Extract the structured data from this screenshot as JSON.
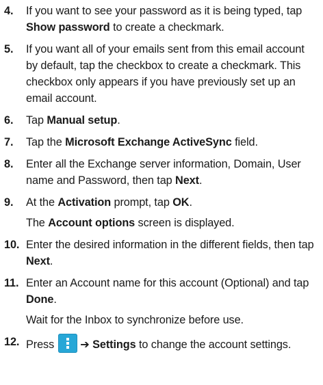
{
  "steps": [
    {
      "num": "4.",
      "pre": "If you want to see your password as it is being typed, tap ",
      "bold": "Show password",
      "post": " to create a checkmark."
    },
    {
      "num": "5.",
      "text": "If you want all of your emails sent from this email account by default, tap the checkbox to create a checkmark. This checkbox only appears if you have previously set up an email account."
    },
    {
      "num": "6.",
      "pre": "Tap ",
      "bold": "Manual setup",
      "post": "."
    },
    {
      "num": "7.",
      "pre": "Tap the ",
      "bold": "Microsoft Exchange ActiveSync",
      "post": " field."
    },
    {
      "num": "8.",
      "pre": "Enter all the Exchange server information, Domain, User name and Password, then tap ",
      "bold": "Next",
      "post": "."
    },
    {
      "num": "9.",
      "pre": "At the ",
      "bold": "Activation",
      "mid": " prompt, tap ",
      "bold2": "OK",
      "post": ".",
      "sub_pre": "The ",
      "sub_bold": "Account options",
      "sub_post": " screen is displayed."
    },
    {
      "num": "10.",
      "pre": "Enter the desired information in the different fields, then tap ",
      "bold": "Next",
      "post": "."
    },
    {
      "num": "11.",
      "pre": "Enter an Account name for this account (Optional) and tap ",
      "bold": "Done",
      "post": ".",
      "sub": "Wait for the Inbox to synchronize before use."
    },
    {
      "num": "12.",
      "pre": "Press",
      "icon": "menu-icon",
      "arrow": "➔",
      "bold": "Settings",
      "post": " to change the account settings."
    }
  ],
  "colors": {
    "menu_icon_bg": "#27a7d7",
    "text": "#1a1a1a"
  }
}
